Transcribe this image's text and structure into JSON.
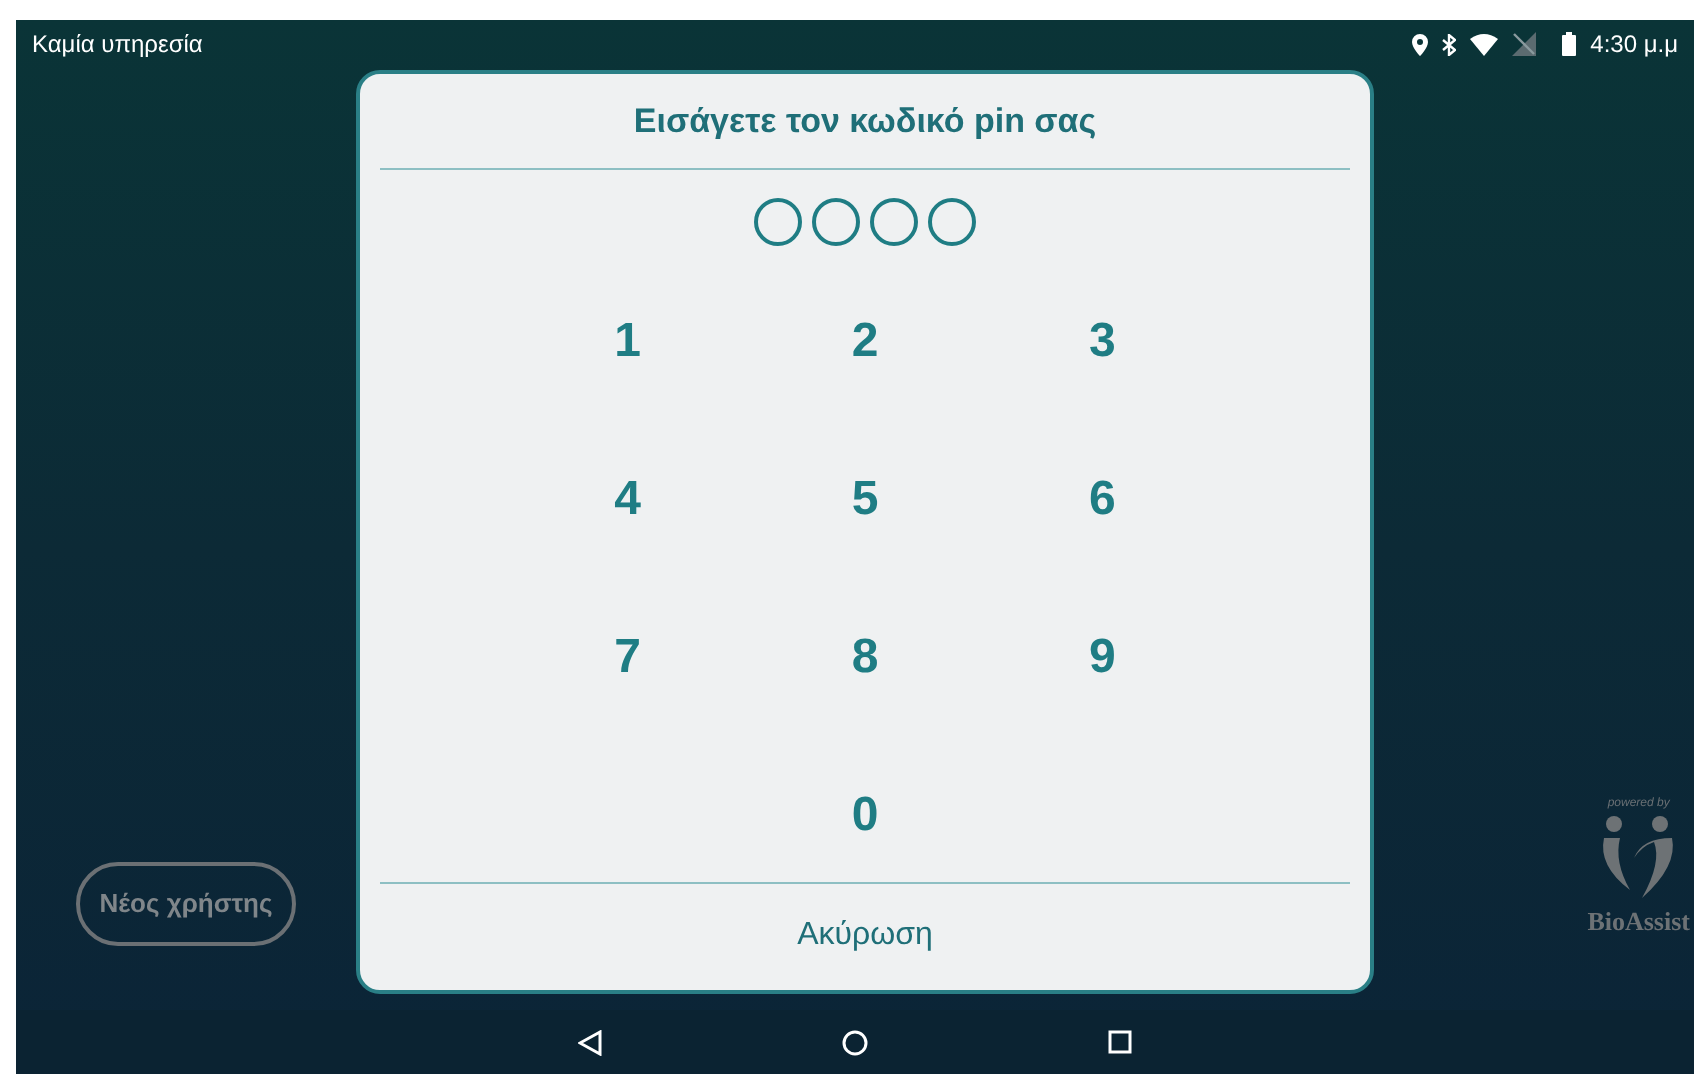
{
  "status_bar": {
    "carrier": "Καμία υπηρεσία",
    "time": "4:30 μ.μ"
  },
  "dialog": {
    "title": "Εισάγετε τον κωδικό pin σας",
    "pin_dots": [
      {
        "filled": false
      },
      {
        "filled": false
      },
      {
        "filled": false
      },
      {
        "filled": false
      }
    ],
    "keys": [
      "1",
      "2",
      "3",
      "4",
      "5",
      "6",
      "7",
      "8",
      "9",
      "0"
    ],
    "cancel": "Ακύρωση"
  },
  "new_user_button": "Νέος χρήστης",
  "logo": {
    "tagline": "powered by",
    "name": "BioAssist"
  }
}
